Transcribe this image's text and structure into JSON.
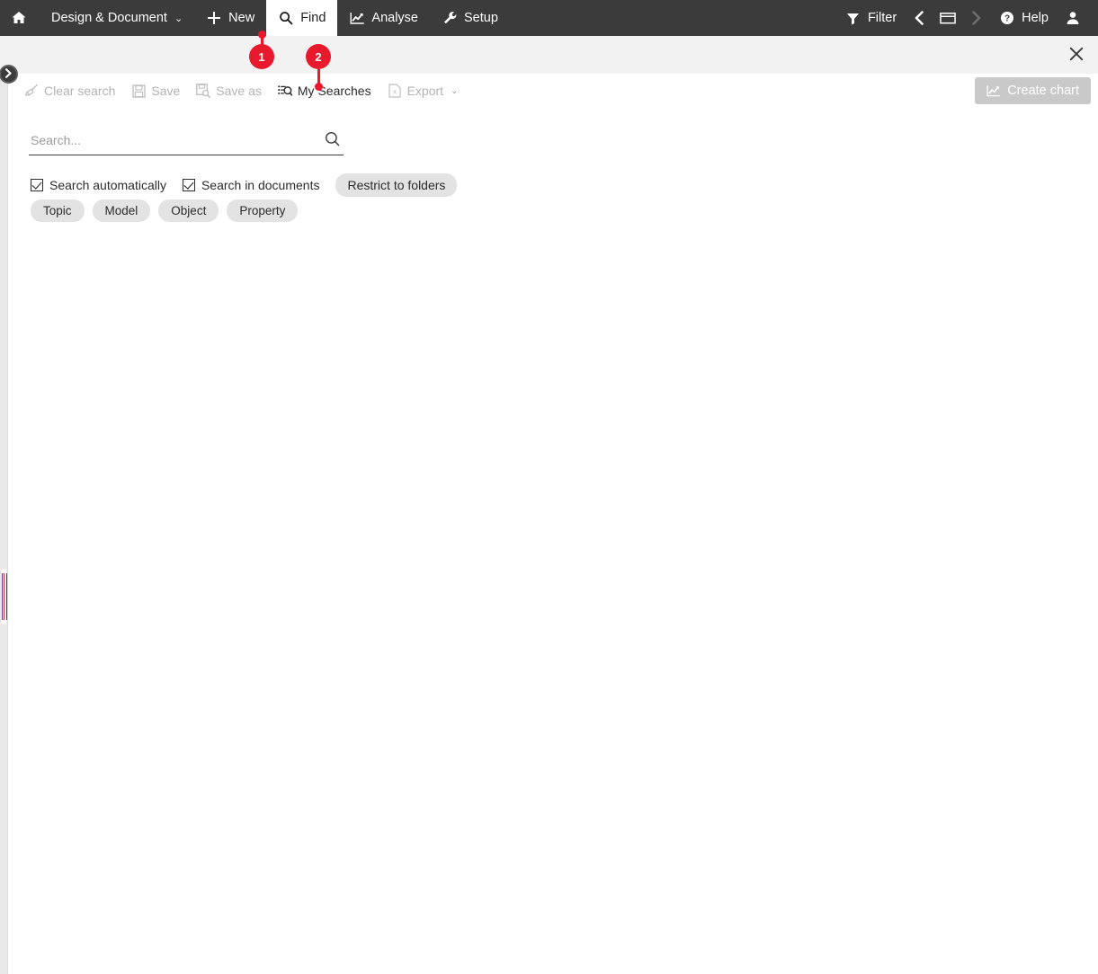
{
  "topbar": {
    "home_icon": "home-icon",
    "items": [
      {
        "label": "Design & Document",
        "icon": "none",
        "caret": "⌄",
        "active": false
      },
      {
        "label": "New",
        "icon": "plus-icon",
        "active": false
      },
      {
        "label": "Find",
        "icon": "magnifier-icon",
        "active": true
      },
      {
        "label": "Analyse",
        "icon": "chart-line-icon",
        "active": false
      },
      {
        "label": "Setup",
        "icon": "wrench-icon",
        "active": false
      }
    ],
    "right": {
      "filter_label": "Filter",
      "filter_icon": "funnel-icon",
      "prev_icon": "chevron-left-icon",
      "window_icon": "window-icon",
      "next_icon": "chevron-right-icon",
      "help_label": "Help",
      "help_icon": "question-circle-icon",
      "user_icon": "user-icon"
    }
  },
  "graybar": {
    "close_icon": "close-icon"
  },
  "rail": {
    "expand_icon": "chevron-right-icon",
    "splitter": "panel-splitter-handle"
  },
  "toolbar": {
    "buttons": [
      {
        "label": "Clear search",
        "icon": "broom-icon",
        "disabled": true
      },
      {
        "label": "Save",
        "icon": "floppy-disk-icon",
        "disabled": true
      },
      {
        "label": "Save as",
        "icon": "floppy-disk-search-icon",
        "disabled": true
      },
      {
        "label": "My Searches",
        "icon": "list-search-icon",
        "disabled": false
      },
      {
        "label": "Export",
        "icon": "excel-file-icon",
        "disabled": true,
        "caret": "⌄"
      }
    ],
    "create_chart": {
      "label": "Create chart",
      "icon": "chart-line-icon",
      "disabled": true
    }
  },
  "search": {
    "value": "",
    "placeholder": "Search...",
    "submit_icon": "magnifier-icon",
    "options": [
      {
        "label": "Search automatically",
        "checked": true
      },
      {
        "label": "Search in documents",
        "checked": true
      }
    ],
    "restrict_label": "Restrict to folders",
    "chips": [
      {
        "label": "Topic"
      },
      {
        "label": "Model"
      },
      {
        "label": "Object"
      },
      {
        "label": "Property"
      }
    ]
  },
  "annotations": [
    {
      "number": "1",
      "target": "find-tab"
    },
    {
      "number": "2",
      "target": "my-searches-button"
    }
  ],
  "colors": {
    "topbar_bg": "#3b3b3b",
    "graybar_bg": "#f2f2f2",
    "annotation_red": "#e8192c",
    "pill_bg": "#e3e3e3",
    "disabled_text": "#b3b3b3",
    "create_chart_bg": "#c9c9c9"
  }
}
